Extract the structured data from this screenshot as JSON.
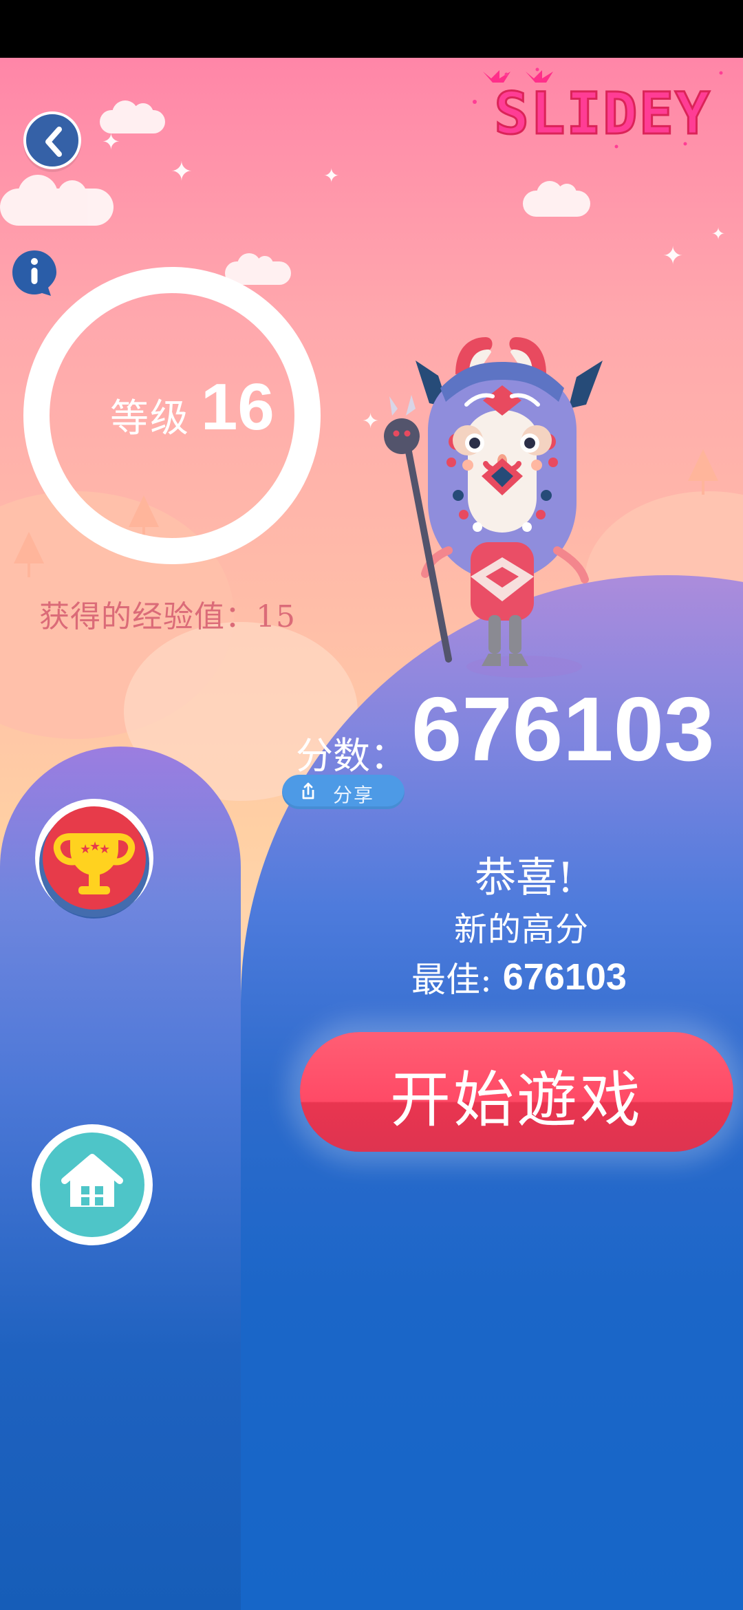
{
  "logo": {
    "text": "SLIDEY"
  },
  "icons": {
    "back": "back-arrow-icon",
    "info": "info-icon",
    "share": "share-icon",
    "trophy": "trophy-icon",
    "home": "home-icon"
  },
  "stats": {
    "level_label": "等级",
    "level_value": "16",
    "exp_text": "获得的经验值：15"
  },
  "score": {
    "label": "分数：",
    "value": "676103",
    "share_label": "分享"
  },
  "result": {
    "congrats": "恭喜!",
    "new_high": "新的高分",
    "best_label": "最佳: ",
    "best_value": "676103"
  },
  "actions": {
    "start_label": "开始遊戏"
  },
  "colors": {
    "primary_red": "#ff4a66",
    "blue": "#1666c8",
    "back_blue": "#3561a7",
    "info_blue": "#2a5da8",
    "trophy_red": "#e73b4a",
    "home_teal": "#4ec5c8"
  }
}
